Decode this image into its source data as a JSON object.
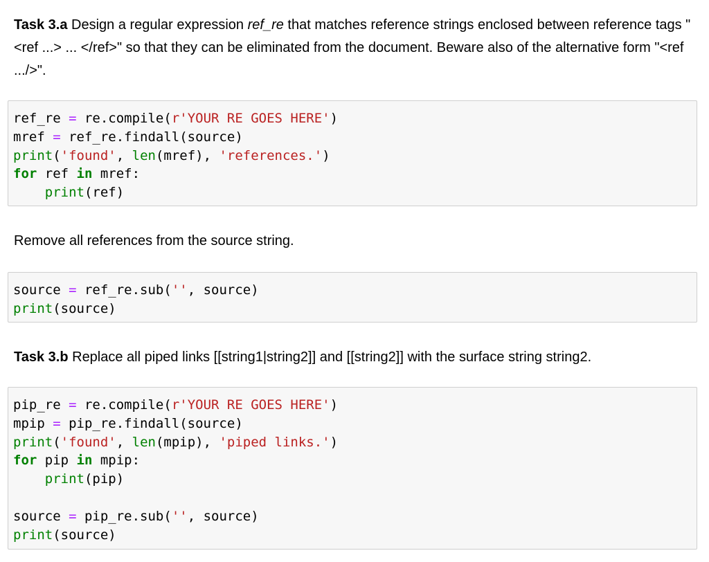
{
  "task_3a": {
    "label": "Task 3.a",
    "text_1": " Design a regular expression ",
    "var_name": "ref_re",
    "text_2": " that matches reference strings enclosed between reference tags \"<ref ...> ... </ref>\" so that they can be eliminated from the document. Beware also of the alternative form \"<ref .../>\"."
  },
  "cell_1": {
    "lines": [
      [
        {
          "t": "ref_re ",
          "c": "p"
        },
        {
          "t": "=",
          "c": "op"
        },
        {
          "t": " re.compile(",
          "c": "p"
        },
        {
          "t": "r'YOUR RE GOES HERE'",
          "c": "str"
        },
        {
          "t": ")",
          "c": "p"
        }
      ],
      [
        {
          "t": "mref ",
          "c": "p"
        },
        {
          "t": "=",
          "c": "op"
        },
        {
          "t": " ref_re.findall(source)",
          "c": "p"
        }
      ],
      [
        {
          "t": "print",
          "c": "bi"
        },
        {
          "t": "(",
          "c": "p"
        },
        {
          "t": "'found'",
          "c": "str"
        },
        {
          "t": ", ",
          "c": "p"
        },
        {
          "t": "len",
          "c": "bi"
        },
        {
          "t": "(mref), ",
          "c": "p"
        },
        {
          "t": "'references.'",
          "c": "str"
        },
        {
          "t": ")",
          "c": "p"
        }
      ],
      [
        {
          "t": "for",
          "c": "kw"
        },
        {
          "t": " ref ",
          "c": "p"
        },
        {
          "t": "in",
          "c": "kw"
        },
        {
          "t": " mref:",
          "c": "p"
        }
      ],
      [
        {
          "t": "    ",
          "c": "p"
        },
        {
          "t": "print",
          "c": "bi"
        },
        {
          "t": "(ref)",
          "c": "p"
        }
      ]
    ]
  },
  "remove_text": "Remove all references from the source string.",
  "cell_2": {
    "lines": [
      [
        {
          "t": "source ",
          "c": "p"
        },
        {
          "t": "=",
          "c": "op"
        },
        {
          "t": " ref_re.sub(",
          "c": "p"
        },
        {
          "t": "''",
          "c": "str"
        },
        {
          "t": ", source)",
          "c": "p"
        }
      ],
      [
        {
          "t": "print",
          "c": "bi"
        },
        {
          "t": "(source)",
          "c": "p"
        }
      ]
    ]
  },
  "task_3b": {
    "label": "Task 3.b",
    "text": " Replace all piped links [[string1|string2]] and [[string2]] with the surface string string2."
  },
  "cell_3": {
    "lines": [
      [
        {
          "t": "pip_re ",
          "c": "p"
        },
        {
          "t": "=",
          "c": "op"
        },
        {
          "t": " re.compile(",
          "c": "p"
        },
        {
          "t": "r'YOUR RE GOES HERE'",
          "c": "str"
        },
        {
          "t": ")",
          "c": "p"
        }
      ],
      [
        {
          "t": "mpip ",
          "c": "p"
        },
        {
          "t": "=",
          "c": "op"
        },
        {
          "t": " pip_re.findall(source)",
          "c": "p"
        }
      ],
      [
        {
          "t": "print",
          "c": "bi"
        },
        {
          "t": "(",
          "c": "p"
        },
        {
          "t": "'found'",
          "c": "str"
        },
        {
          "t": ", ",
          "c": "p"
        },
        {
          "t": "len",
          "c": "bi"
        },
        {
          "t": "(mpip), ",
          "c": "p"
        },
        {
          "t": "'piped links.'",
          "c": "str"
        },
        {
          "t": ")",
          "c": "p"
        }
      ],
      [
        {
          "t": "for",
          "c": "kw"
        },
        {
          "t": " pip ",
          "c": "p"
        },
        {
          "t": "in",
          "c": "kw"
        },
        {
          "t": " mpip:",
          "c": "p"
        }
      ],
      [
        {
          "t": "    ",
          "c": "p"
        },
        {
          "t": "print",
          "c": "bi"
        },
        {
          "t": "(pip)",
          "c": "p"
        }
      ],
      [],
      [
        {
          "t": "source ",
          "c": "p"
        },
        {
          "t": "=",
          "c": "op"
        },
        {
          "t": " pip_re.sub(",
          "c": "p"
        },
        {
          "t": "''",
          "c": "str"
        },
        {
          "t": ", source)",
          "c": "p"
        }
      ],
      [
        {
          "t": "print",
          "c": "bi"
        },
        {
          "t": "(source)",
          "c": "p"
        }
      ]
    ]
  },
  "colors": {
    "keyword": "#008000",
    "builtin": "#008000",
    "operator": "#aa22ff",
    "string": "#ba2121",
    "cell_background": "#f7f7f7",
    "cell_border": "#cfcfcf"
  }
}
